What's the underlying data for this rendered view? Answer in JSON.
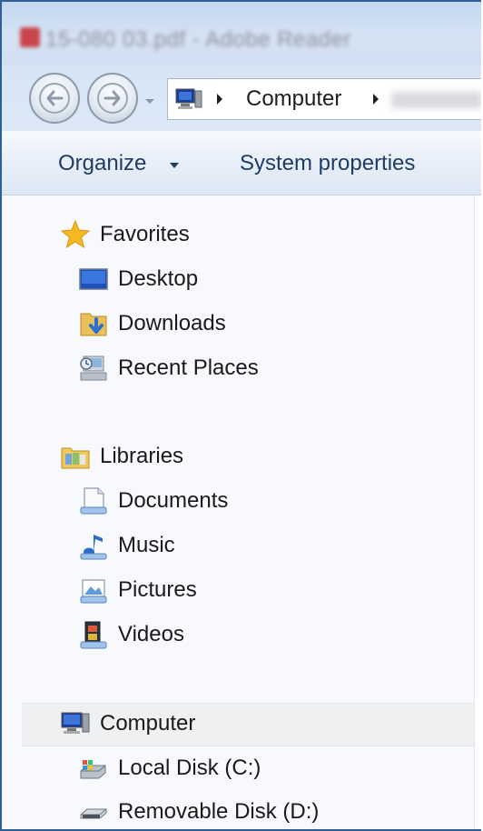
{
  "window": {
    "title_blurred": "15-080 03.pdf - Adobe Reader"
  },
  "address_bar": {
    "location": "Computer"
  },
  "toolbar": {
    "organize_label": "Organize",
    "system_properties_label": "System properties"
  },
  "navigation_pane": {
    "favorites": {
      "label": "Favorites",
      "items": [
        {
          "label": "Desktop",
          "icon": "desktop-icon"
        },
        {
          "label": "Downloads",
          "icon": "downloads-icon"
        },
        {
          "label": "Recent Places",
          "icon": "recent-places-icon"
        }
      ]
    },
    "libraries": {
      "label": "Libraries",
      "items": [
        {
          "label": "Documents",
          "icon": "documents-icon"
        },
        {
          "label": "Music",
          "icon": "music-icon"
        },
        {
          "label": "Pictures",
          "icon": "pictures-icon"
        },
        {
          "label": "Videos",
          "icon": "videos-icon"
        }
      ]
    },
    "computer": {
      "label": "Computer",
      "selected": true,
      "items": [
        {
          "label": "Local Disk (C:)",
          "icon": "local-disk-icon"
        },
        {
          "label": "Removable Disk (D:)",
          "icon": "removable-disk-icon"
        }
      ]
    }
  },
  "colors": {
    "window_border": "#2f5f97",
    "toolbar_text": "#1f3d63",
    "selection_bg": "#eef0f2"
  }
}
